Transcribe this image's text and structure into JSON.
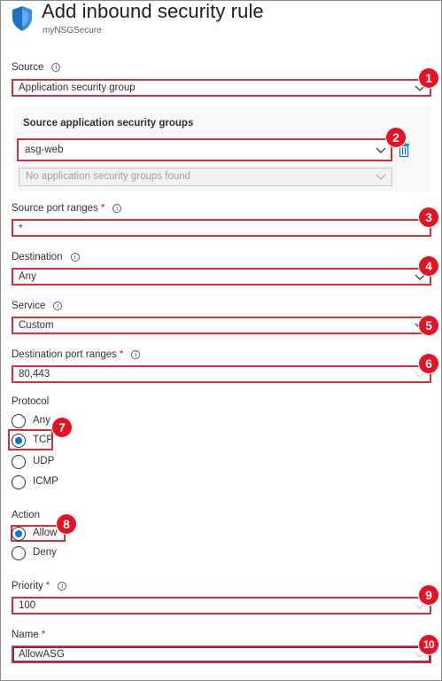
{
  "header": {
    "title": "Add inbound security rule",
    "subtitle": "myNSGSecure"
  },
  "source": {
    "label": "Source",
    "value": "Application security group"
  },
  "source_asg": {
    "section_title": "Source application security groups",
    "value": "asg-web",
    "empty_placeholder": "No application security groups found"
  },
  "source_port": {
    "label": "Source port ranges",
    "required": "*",
    "value": "*"
  },
  "destination": {
    "label": "Destination",
    "value": "Any"
  },
  "service": {
    "label": "Service",
    "value": "Custom"
  },
  "dest_port": {
    "label": "Destination port ranges",
    "required": "*",
    "value": "80,443"
  },
  "protocol": {
    "label": "Protocol",
    "options": [
      "Any",
      "TCP",
      "UDP",
      "ICMP"
    ],
    "selected": "TCP"
  },
  "action": {
    "label": "Action",
    "options": [
      "Allow",
      "Deny"
    ],
    "selected": "Allow"
  },
  "priority": {
    "label": "Priority",
    "required": "*",
    "value": "100"
  },
  "name": {
    "label": "Name",
    "required": "*",
    "value": "AllowASG"
  },
  "info_glyph": "i",
  "badges": [
    "1",
    "2",
    "3",
    "4",
    "5",
    "6",
    "7",
    "8",
    "9",
    "10"
  ],
  "colors": {
    "highlight": "#d13438",
    "badge": "#e81123",
    "accent": "#0078d4"
  }
}
